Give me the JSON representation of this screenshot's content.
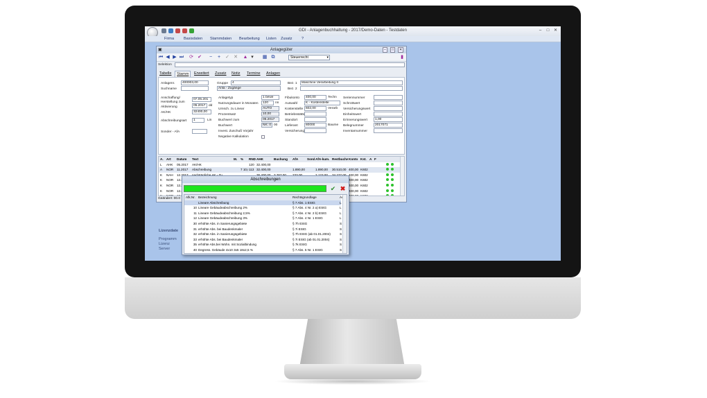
{
  "app": {
    "title": "GDI - Anlagenbuchhaltung - 2017/Demo-Daten - Testdaten",
    "menu": [
      "Firma",
      "Basisdaten",
      "Stammdaten",
      "Bearbeitung",
      "Listen",
      "Zusatz",
      "?"
    ]
  },
  "window": {
    "title": "Anlagegüter",
    "view_select": "Steuerrecht",
    "selektion_label": "Selektion",
    "tabs": [
      "Tabelle",
      "Stamm",
      "Erweitert",
      "Zusatz",
      "Notiz",
      "Termine",
      "Anlagen"
    ],
    "active_tab": "Stamm",
    "form": {
      "anlagenr_label": "Anlagenr.",
      "anlagenr_value": "400003,00",
      "suchname_label": "Suchname",
      "gruppe_label": "Gruppe",
      "gruppe_value": "4",
      "gruppe_desc": "Anla - Zugänge",
      "bez1_label": "Bez. 1",
      "bez1_value": "Maschine Verarbeitung II",
      "bez2_label": "Bez. 2",
      "anschaffung_label": "Anschaffung/ Herstellung zum",
      "anschaffung_value": "07.05.201",
      "aktivierung_label": "Aktivierung",
      "aktivierung_value": "05.2017",
      "aktivierung_unit": "dd",
      "akhk_label": "AK/HK",
      "akhk_value": "32400,00",
      "abschreibungsart_label": "Abschreibungsart",
      "abschreibungsart_value": "1",
      "abschreibungsart_unit": "Lin",
      "sonder_afa_label": "Sonder - AfA",
      "anlagetyp_label": "Anlagetyp",
      "anlagetyp_value": "1 bewe",
      "nutzungsdauer_label": "Nutzungsdauer in Monaten",
      "nutzungsdauer_value": "120",
      "nutzungsdauer_unit": "nn",
      "umsch_label": "Umsch. zu Linear",
      "umsch_value": "AUTO",
      "prozentsatz_label": "Prozentsatz",
      "prozentsatz_value": "10,00",
      "buchwert_zum_label": "Buchwert zum",
      "buchwert_zum_value": "05.2017",
      "buchwert_label": "Buchwert",
      "buchwert_value": "NK: 0",
      "buchwert_unit": "00",
      "invest_label": "Invest. Zuschuß Vorjahr",
      "negative_label": "Negative Kalkulation",
      "fibukonto_label": "Fibukonto",
      "fibukonto_value": "400,00",
      "fibukonto_unit": "Techn",
      "auswahl_label": "Auswahl",
      "auswahl_value": "K - Kostenstelle",
      "kostenstelle_label": "Kostenstelle",
      "kostenstelle_value": "602,00",
      "kostenstelle_unit": "Verarb",
      "betriebsstaette_label": "Betriebsstätte",
      "standort_label": "Standort",
      "lieferant_label": "Lieferant",
      "lieferant_value": "80000",
      "lieferant_unit": "Baume",
      "versicherung_label": "Versicherung",
      "seriennummer_label": "Seriennummer",
      "schrottwert_label": "Schrottwert",
      "versicherungswert_label": "Versicherungswert",
      "einheitswert_label": "Einheitswert",
      "erinnerungswert_label": "Erinnerungswert",
      "erinnerungswert_value": "1,00",
      "belegnummer_label": "Belegnummer",
      "belegnummer_value": "2017071",
      "inventarnummer_label": "Inventarnummer"
    },
    "grid": {
      "columns": [
        "A.",
        "Art",
        "Datum",
        "Text",
        "M.",
        "%",
        "RND",
        "AHK",
        "Buchung",
        "AfA",
        "Sond",
        "AfA-kum.",
        "Restbuchw.",
        "Konto",
        "Kst.",
        "A",
        "F"
      ],
      "rows": [
        [
          "L",
          "AHK",
          "05.2017",
          "AK/HK",
          "",
          "",
          "120",
          "32.400,00",
          "",
          "",
          "",
          "",
          "",
          "",
          "",
          "",
          ""
        ],
        [
          "A",
          "NOR",
          "11.2017",
          "Abschreibung",
          "",
          "7 10,00",
          "113",
          "32.400,00",
          "",
          "1.890,00",
          "",
          "1.890,00",
          "30.510,00",
          "400,00",
          "K602",
          "",
          ""
        ],
        [
          "K",
          "NAH",
          "12.2017",
          "nachträgliche AK - Zu",
          "",
          "",
          "",
          "36.400,00",
          "3.767,00",
          "233,00",
          "",
          "2.123,00",
          "34.277,00",
          "400,00",
          "K602",
          "",
          ""
        ],
        [
          "K",
          "NOR",
          "12.2017",
          "Abschreibung",
          "",
          "1 10,00",
          "112",
          "36.400,00",
          "",
          "303,00",
          "",
          "2.426,00",
          "33.974,00",
          "400,00",
          "K602",
          "",
          ""
        ],
        [
          "K",
          "NOR",
          "12.2017",
          "Abschreibung",
          "",
          "",
          "",
          "",
          "",
          "1.640,00",
          "",
          "",
          "32.334,00",
          "400,00",
          "K602",
          "",
          ""
        ],
        [
          "K",
          "NOR",
          "12.2018",
          "Abschreibung",
          "",
          "",
          "",
          "",
          "",
          "",
          "",
          "",
          "5.694,00",
          "400,00",
          "K602",
          "",
          ""
        ],
        [
          "K",
          "NOR",
          "12.2019",
          "Abschreibung",
          "",
          "",
          "",
          "",
          "",
          "",
          "",
          "",
          "3.054,00",
          "400,00",
          "K602",
          "",
          ""
        ]
      ]
    },
    "status_text": "Geändert: 00.0"
  },
  "dialog": {
    "title": "Abschreibungen",
    "columns": [
      "Afk.Nr.",
      "Bezeichnung",
      "Rechtsgrundlage",
      "A/E"
    ],
    "rows": [
      [
        "",
        "Lineare Abschreibung",
        "§ 7 Abs. 1 EStG",
        "L"
      ],
      [
        "10",
        "Lineare Gebäudeabschreibung 2%",
        "§ 7 Abs. 4 Nr. 2 a) EStG",
        "L"
      ],
      [
        "11",
        "Lineare Gebäudeabschreibung 2,5%",
        "§ 7 Abs. 4 Nr. 2 b) EStG",
        "L"
      ],
      [
        "12",
        "Lineare Gebäudeabschreibung 3%",
        "§ 7 Abs. 4 Nr. 1 EStG",
        "L"
      ],
      [
        "30",
        "erhöhte Abs. in Sanierungsgebiete",
        "§ 7h EStG",
        "S"
      ],
      [
        "31",
        "erhöhte Abs. bei Baudenkmaler",
        "§ 7i EStG",
        "S"
      ],
      [
        "32",
        "erhöhte Abs. in Sanierungsgebiete",
        "§ 7h EStG (ab 01.01.2004)",
        "S"
      ],
      [
        "33",
        "erhöhte Abs. bei Baudenkmaler",
        "§ 7i EStG (ab 01.01.2004)",
        "S"
      ],
      [
        "35",
        "erhöhte Abs.bei Wohn. mit Sozialbindung",
        "§ 7k EStG",
        "S"
      ],
      [
        "40",
        "Degress. Gebäude 4x10 3x5 18x2,5 %",
        "§ 7 Abs. 5 Nr. 1 EStG",
        "S"
      ]
    ]
  },
  "sidebar": {
    "lizenz_heading": "Lizenzdate",
    "lines": [
      "Programm",
      "Lizenz",
      "Server"
    ]
  }
}
